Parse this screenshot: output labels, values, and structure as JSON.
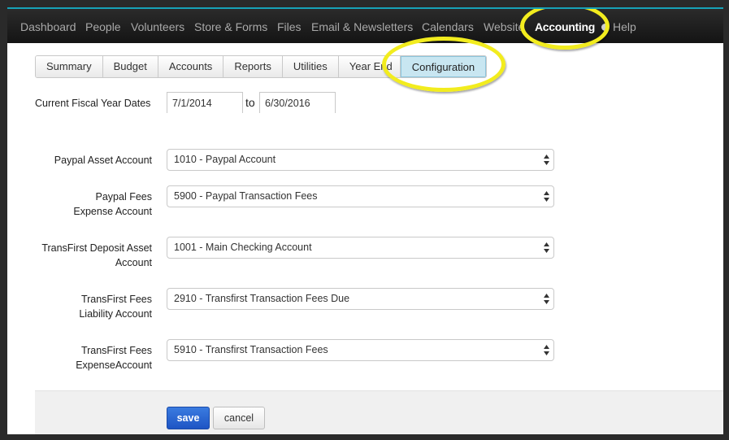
{
  "nav": {
    "items": [
      {
        "label": "Dashboard"
      },
      {
        "label": "People"
      },
      {
        "label": "Volunteers"
      },
      {
        "label": "Store & Forms"
      },
      {
        "label": "Files"
      },
      {
        "label": "Email & Newsletters"
      },
      {
        "label": "Calendars"
      },
      {
        "label": "Website"
      },
      {
        "label": "Accounting"
      },
      {
        "label": "Help"
      }
    ],
    "active": "Accounting"
  },
  "tabs": {
    "items": [
      {
        "label": "Summary"
      },
      {
        "label": "Budget"
      },
      {
        "label": "Accounts"
      },
      {
        "label": "Reports"
      },
      {
        "label": "Utilities"
      },
      {
        "label": "Year End"
      },
      {
        "label": "Configuration"
      }
    ],
    "active": "Configuration"
  },
  "fiscal": {
    "label": "Current Fiscal Year Dates",
    "start": "7/1/2014",
    "separator": "to",
    "end": "6/30/2016"
  },
  "fields": [
    {
      "label_line1": "Paypal Asset Account",
      "label_line2": "",
      "value": "1010 - Paypal Account"
    },
    {
      "label_line1": "Paypal Fees",
      "label_line2": "Expense Account",
      "value": "5900 - Paypal Transaction Fees"
    },
    {
      "label_line1": "TransFirst Deposit Asset",
      "label_line2": "Account",
      "value": "1001 - Main Checking Account"
    },
    {
      "label_line1": "TransFirst Fees",
      "label_line2": "Liability Account",
      "value": "2910 - Transfirst Transaction Fees Due"
    },
    {
      "label_line1": "TransFirst Fees",
      "label_line2": "ExpenseAccount",
      "value": "5910 - Transfirst Transaction Fees"
    }
  ],
  "footer": {
    "save_label": "save",
    "cancel_label": "cancel"
  },
  "colors": {
    "highlight": "#f2ec1e",
    "save_button": "#2563d6",
    "active_tab": "#c8e6f1",
    "nav_accent": "#1db0c6"
  }
}
